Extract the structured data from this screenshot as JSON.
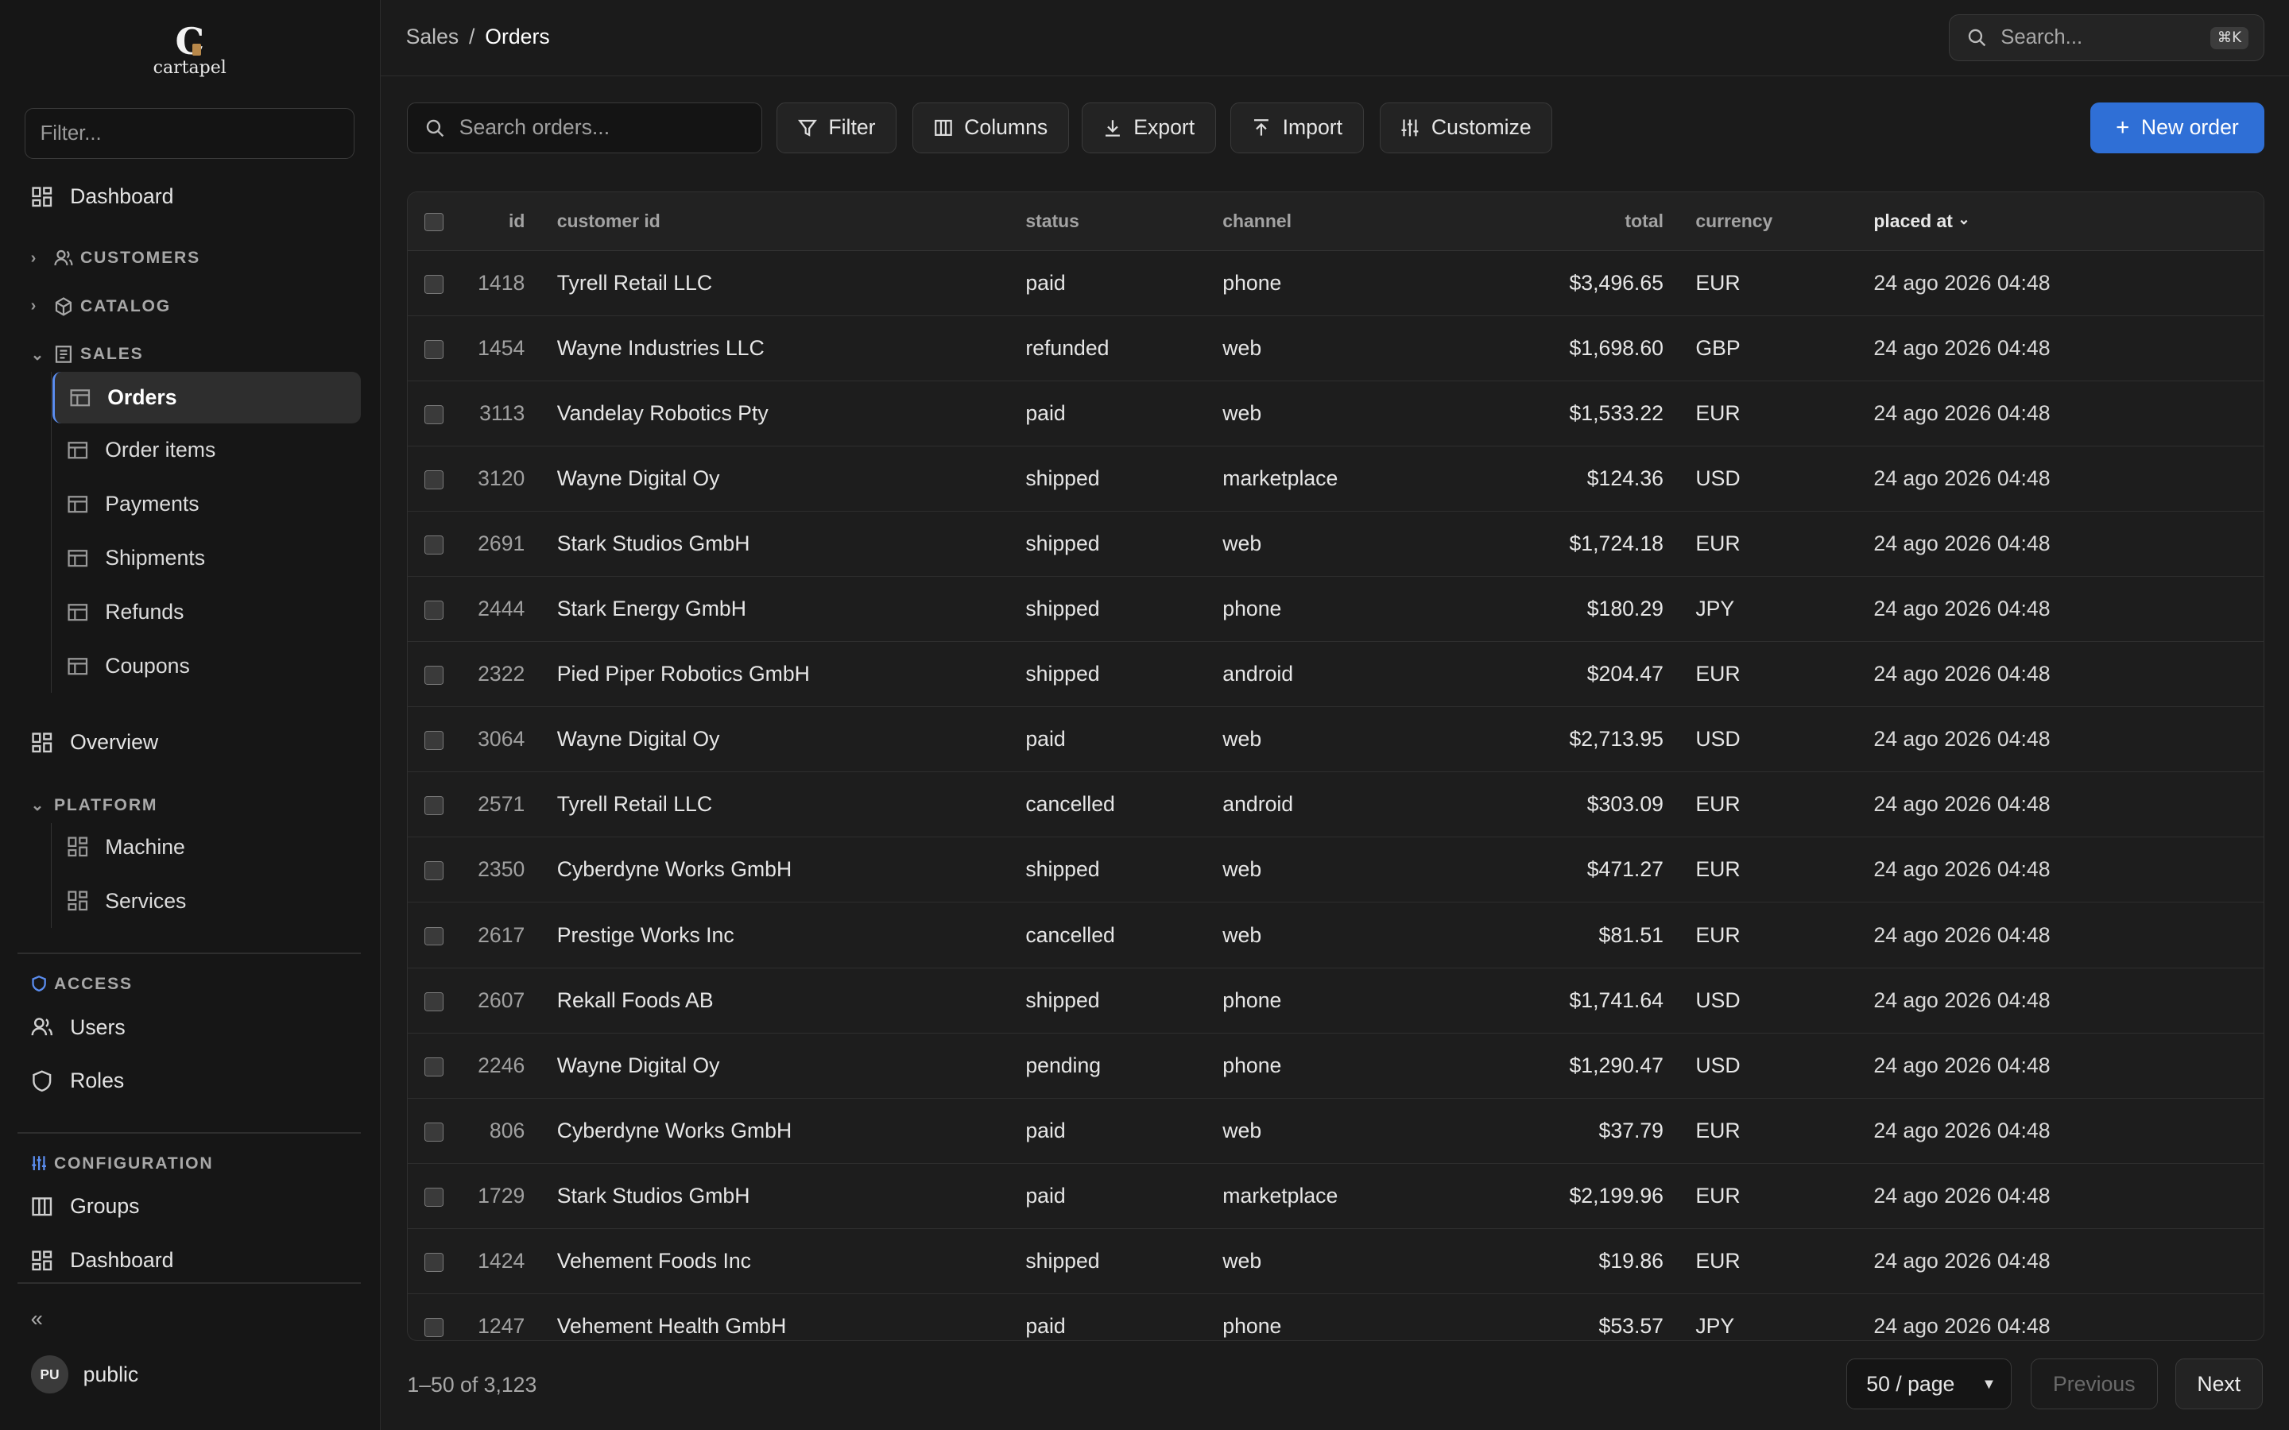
{
  "app": {
    "logo_mark": "C",
    "logo_name": "cartapel"
  },
  "sidebar": {
    "filter_placeholder": "Filter...",
    "dashboard": "Dashboard",
    "customers": "CUSTOMERS",
    "catalog": "CATALOG",
    "sales": "SALES",
    "sales_items": [
      "Orders",
      "Order items",
      "Payments",
      "Shipments",
      "Refunds",
      "Coupons"
    ],
    "overview": "Overview",
    "platform": "PLATFORM",
    "platform_items": [
      "Machine",
      "Services"
    ],
    "access": "ACCESS",
    "users": "Users",
    "roles": "Roles",
    "configuration": "CONFIGURATION",
    "groups": "Groups",
    "config_dashboard": "Dashboard",
    "user_initials": "PU",
    "user_name": "public"
  },
  "header": {
    "breadcrumb_parent": "Sales",
    "breadcrumb_sep": "/",
    "breadcrumb_current": "Orders",
    "search_placeholder": "Search...",
    "search_shortcut": "⌘K"
  },
  "toolbar": {
    "search_placeholder": "Search orders...",
    "filter": "Filter",
    "columns": "Columns",
    "export": "Export",
    "import": "Import",
    "customize": "Customize",
    "new_order": "New order"
  },
  "table": {
    "columns": [
      "id",
      "customer id",
      "status",
      "channel",
      "total",
      "currency",
      "placed at"
    ],
    "sort_indicator": "⌄",
    "rows": [
      [
        "1418",
        "Tyrell Retail LLC",
        "paid",
        "phone",
        "$3,496.65",
        "EUR",
        "24 ago 2026 04:48"
      ],
      [
        "1454",
        "Wayne Industries LLC",
        "refunded",
        "web",
        "$1,698.60",
        "GBP",
        "24 ago 2026 04:48"
      ],
      [
        "3113",
        "Vandelay Robotics Pty",
        "paid",
        "web",
        "$1,533.22",
        "EUR",
        "24 ago 2026 04:48"
      ],
      [
        "3120",
        "Wayne Digital Oy",
        "shipped",
        "marketplace",
        "$124.36",
        "USD",
        "24 ago 2026 04:48"
      ],
      [
        "2691",
        "Stark Studios GmbH",
        "shipped",
        "web",
        "$1,724.18",
        "EUR",
        "24 ago 2026 04:48"
      ],
      [
        "2444",
        "Stark Energy GmbH",
        "shipped",
        "phone",
        "$180.29",
        "JPY",
        "24 ago 2026 04:48"
      ],
      [
        "2322",
        "Pied Piper Robotics GmbH",
        "shipped",
        "android",
        "$204.47",
        "EUR",
        "24 ago 2026 04:48"
      ],
      [
        "3064",
        "Wayne Digital Oy",
        "paid",
        "web",
        "$2,713.95",
        "USD",
        "24 ago 2026 04:48"
      ],
      [
        "2571",
        "Tyrell Retail LLC",
        "cancelled",
        "android",
        "$303.09",
        "EUR",
        "24 ago 2026 04:48"
      ],
      [
        "2350",
        "Cyberdyne Works GmbH",
        "shipped",
        "web",
        "$471.27",
        "EUR",
        "24 ago 2026 04:48"
      ],
      [
        "2617",
        "Prestige Works Inc",
        "cancelled",
        "web",
        "$81.51",
        "EUR",
        "24 ago 2026 04:48"
      ],
      [
        "2607",
        "Rekall Foods AB",
        "shipped",
        "phone",
        "$1,741.64",
        "USD",
        "24 ago 2026 04:48"
      ],
      [
        "2246",
        "Wayne Digital Oy",
        "pending",
        "phone",
        "$1,290.47",
        "USD",
        "24 ago 2026 04:48"
      ],
      [
        "806",
        "Cyberdyne Works GmbH",
        "paid",
        "web",
        "$37.79",
        "EUR",
        "24 ago 2026 04:48"
      ],
      [
        "1729",
        "Stark Studios GmbH",
        "paid",
        "marketplace",
        "$2,199.96",
        "EUR",
        "24 ago 2026 04:48"
      ],
      [
        "1424",
        "Vehement Foods Inc",
        "shipped",
        "web",
        "$19.86",
        "EUR",
        "24 ago 2026 04:48"
      ],
      [
        "1247",
        "Vehement Health GmbH",
        "paid",
        "phone",
        "$53.57",
        "JPY",
        "24 ago 2026 04:48"
      ]
    ]
  },
  "footer": {
    "count": "1–50 of 3,123",
    "per_page": "50 / page",
    "previous": "Previous",
    "next": "Next"
  },
  "colors": {
    "accent": "#2f6fd6",
    "background": "#1b1b1b",
    "sidebar": "#161616"
  }
}
